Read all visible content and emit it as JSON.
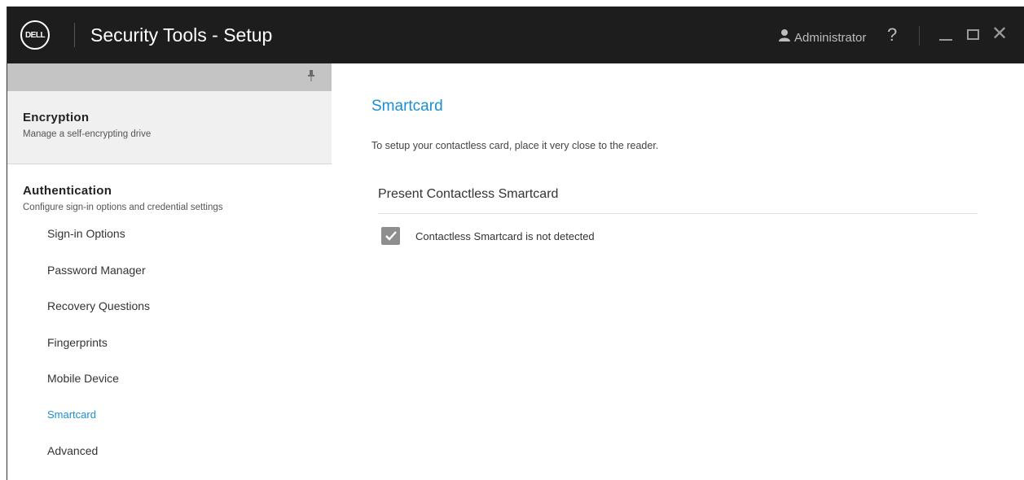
{
  "window": {
    "title": "Security Tools - Setup",
    "logo_text": "DELL",
    "user": "Administrator",
    "help": "?"
  },
  "sidebar": {
    "encryption": {
      "title": "Encryption",
      "subtitle": "Manage a self-encrypting drive"
    },
    "authentication": {
      "title": "Authentication",
      "subtitle": "Configure sign-in options and credential settings"
    },
    "items": [
      {
        "label": "Sign-in Options"
      },
      {
        "label": "Password Manager"
      },
      {
        "label": "Recovery Questions"
      },
      {
        "label": "Fingerprints"
      },
      {
        "label": "Mobile Device"
      },
      {
        "label": "Smartcard"
      },
      {
        "label": "Advanced"
      }
    ],
    "active_item": "Smartcard"
  },
  "main": {
    "title": "Smartcard",
    "description": "To setup your contactless card, place it very close to the reader.",
    "group_title": "Present Contactless Smartcard",
    "status": {
      "label": "Contactless Smartcard is not detected",
      "checked": true
    }
  },
  "colors": {
    "titlebar": "#1d1d1d",
    "accent": "#1a8fd1",
    "pin_bar": "#c4c4c4",
    "section_bg": "#f0f0f0",
    "checkbox": "#8e8e8e"
  }
}
